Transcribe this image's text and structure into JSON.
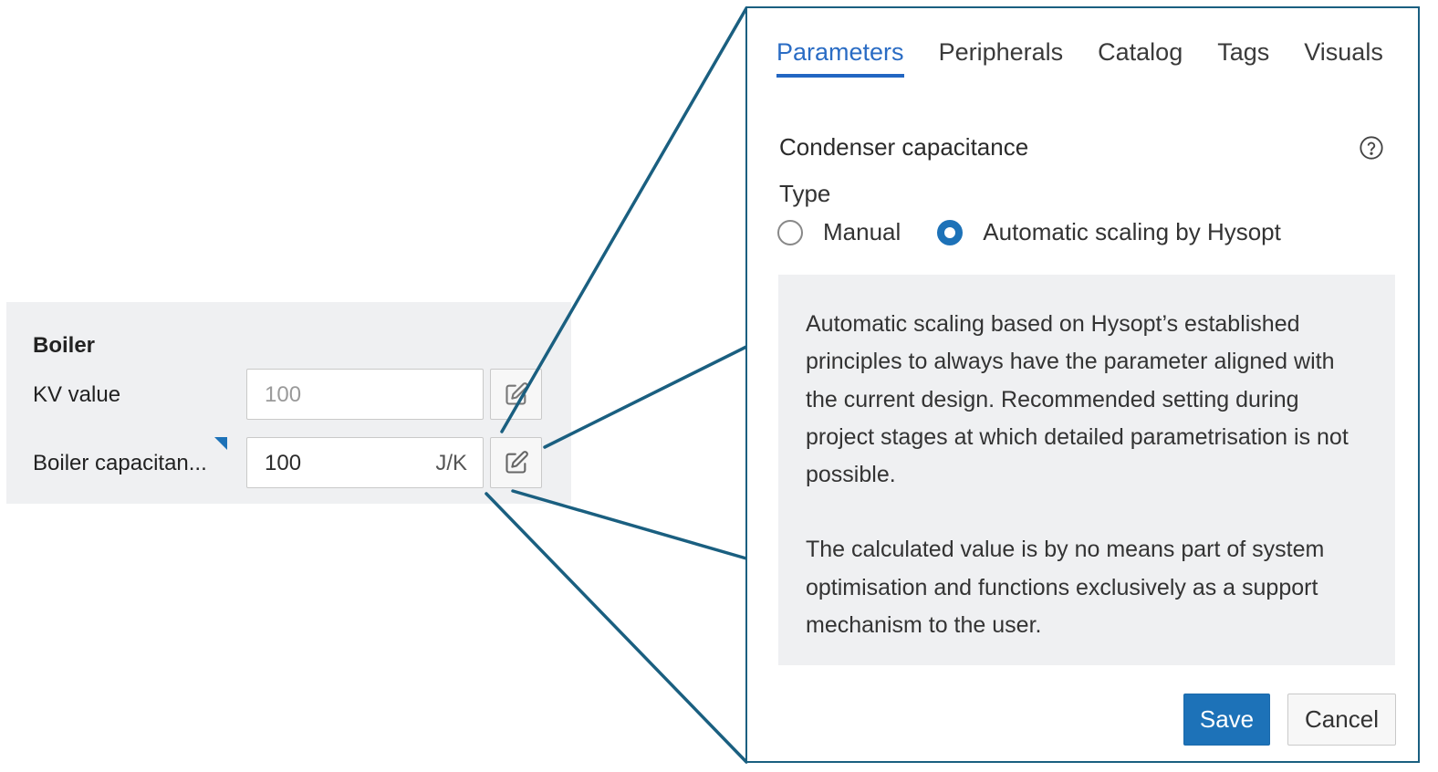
{
  "panel": {
    "section_title": "Boiler",
    "rows": [
      {
        "label": "KV value",
        "value": "100",
        "unit": "",
        "placeholder": true
      },
      {
        "label": "Boiler capacitan...",
        "value": "100",
        "unit": "J/K",
        "placeholder": false
      }
    ],
    "edit_icon": "pencil-square-icon"
  },
  "dialog": {
    "tabs": [
      {
        "label": "Parameters",
        "active": true
      },
      {
        "label": "Peripherals",
        "active": false
      },
      {
        "label": "Catalog",
        "active": false
      },
      {
        "label": "Tags",
        "active": false
      },
      {
        "label": "Visuals",
        "active": false
      }
    ],
    "heading": "Condenser capacitance",
    "help_icon": "question-circle-icon",
    "type_label": "Type",
    "radio_options": [
      {
        "label": "Manual",
        "checked": false
      },
      {
        "label": "Automatic scaling by Hysopt",
        "checked": true
      }
    ],
    "info_paragraphs": [
      "Automatic scaling based on Hysopt’s established principles to always have the parameter aligned with the current design. Recommended setting during project stages at which detailed parametrisation is not possible.",
      "The calculated value is by no means part of system optimisation and functions exclusively as a support mechanism to the user."
    ],
    "save_label": "Save",
    "cancel_label": "Cancel"
  },
  "colors": {
    "accent": "#1d72b8",
    "tab_active": "#2a6cc4",
    "connector": "#1a5f80",
    "panel_bg": "#eff0f2"
  }
}
